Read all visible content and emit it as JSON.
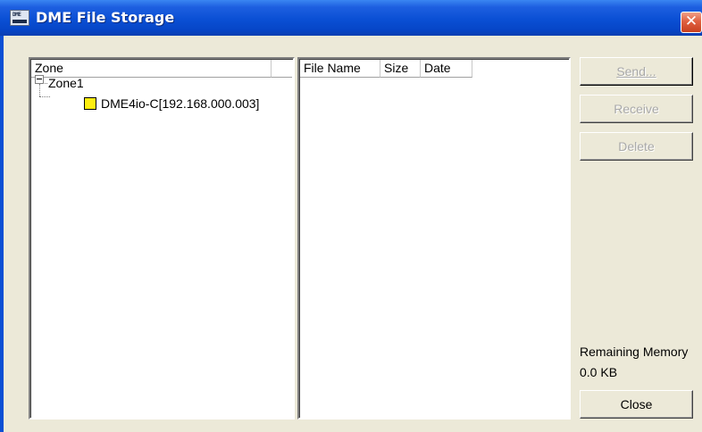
{
  "window": {
    "title": "DME File Storage",
    "icon": "dme-app-icon",
    "icon_text": "DME",
    "close_glyph": "✕"
  },
  "zone_panel": {
    "header": "Zone",
    "tree": {
      "root": {
        "label": "Zone1",
        "expanded": true
      },
      "children": [
        {
          "label": "DME4io-C[192.168.000.003]",
          "icon": "yellow-square-device-icon",
          "icon_color": "#ffee10"
        }
      ]
    }
  },
  "file_list": {
    "columns": [
      "File Name",
      "Size",
      "Date"
    ],
    "rows": []
  },
  "buttons": {
    "send": "Send...",
    "receive": "Receive",
    "delete": "Delete",
    "close": "Close"
  },
  "memory": {
    "label": "Remaining Memory",
    "value": "0.0 KB"
  },
  "colors": {
    "titlebar": "#0a4fd4",
    "client_bg": "#ece9d8",
    "close_button": "#e06040"
  }
}
